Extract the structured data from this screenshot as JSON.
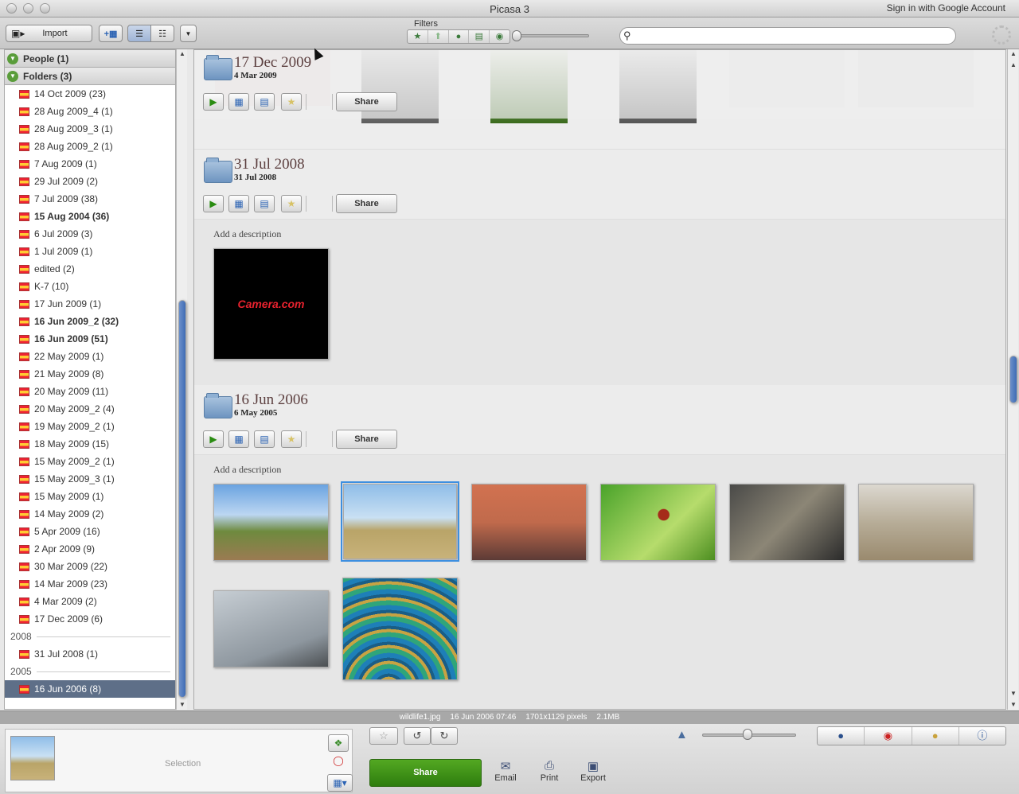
{
  "window": {
    "title": "Picasa 3",
    "signin": "Sign in with Google Account"
  },
  "toolbar": {
    "import_label": "Import",
    "filters_label": "Filters",
    "search_placeholder": ""
  },
  "sidebar": {
    "people": "People (1)",
    "folders": "Folders (3)",
    "items": [
      {
        "label": "14 Oct 2009 (23)",
        "bold": false
      },
      {
        "label": "28 Aug 2009_4 (1)",
        "bold": false
      },
      {
        "label": "28 Aug 2009_3 (1)",
        "bold": false
      },
      {
        "label": "28 Aug 2009_2 (1)",
        "bold": false
      },
      {
        "label": "7 Aug 2009 (1)",
        "bold": false
      },
      {
        "label": "29 Jul 2009 (2)",
        "bold": false
      },
      {
        "label": "7 Jul 2009 (38)",
        "bold": false
      },
      {
        "label": "15 Aug 2004 (36)",
        "bold": true
      },
      {
        "label": "6 Jul 2009 (3)",
        "bold": false
      },
      {
        "label": "1 Jul 2009 (1)",
        "bold": false
      },
      {
        "label": "edited (2)",
        "bold": false
      },
      {
        "label": "K-7 (10)",
        "bold": false
      },
      {
        "label": "17 Jun 2009 (1)",
        "bold": false
      },
      {
        "label": "16 Jun 2009_2 (32)",
        "bold": true
      },
      {
        "label": "16 Jun 2009 (51)",
        "bold": true
      },
      {
        "label": "22 May 2009 (1)",
        "bold": false
      },
      {
        "label": "21 May 2009 (8)",
        "bold": false
      },
      {
        "label": "20 May 2009 (11)",
        "bold": false
      },
      {
        "label": "20 May 2009_2 (4)",
        "bold": false
      },
      {
        "label": "19 May 2009_2 (1)",
        "bold": false
      },
      {
        "label": "18 May 2009 (15)",
        "bold": false
      },
      {
        "label": "15 May 2009_2 (1)",
        "bold": false
      },
      {
        "label": "15 May 2009_3 (1)",
        "bold": false
      },
      {
        "label": "15 May 2009 (1)",
        "bold": false
      },
      {
        "label": "14 May 2009 (2)",
        "bold": false
      },
      {
        "label": "5 Apr 2009 (16)",
        "bold": false
      },
      {
        "label": "2 Apr 2009 (9)",
        "bold": false
      },
      {
        "label": "30 Mar 2009 (22)",
        "bold": false
      },
      {
        "label": "14 Mar 2009 (23)",
        "bold": false
      },
      {
        "label": "4 Mar 2009 (2)",
        "bold": false
      },
      {
        "label": "17 Dec 2009 (6)",
        "bold": false
      }
    ],
    "year_2008": "2008",
    "item_2008": "31 Jul 2008 (1)",
    "year_2005": "2005",
    "item_2005": "16 Jun 2006 (8)"
  },
  "albums": [
    {
      "title": "17 Dec 2009",
      "date": "4 Mar 2009",
      "share": "Share"
    },
    {
      "title": "31 Jul 2008",
      "date": "31 Jul 2008",
      "share": "Share",
      "description": "Add a description"
    },
    {
      "title": "16 Jun 2006",
      "date": "6 May 2005",
      "share": "Share",
      "description": "Add a description"
    }
  ],
  "logo_text": "Camera.com",
  "status": {
    "filename": "wildlife1.jpg",
    "datetime": "16 Jun 2006 07:46",
    "dimensions": "1701x1129 pixels",
    "size": "2.1MB"
  },
  "bottom": {
    "selection": "Selection",
    "share": "Share",
    "email": "Email",
    "print": "Print",
    "export": "Export"
  },
  "colors": {
    "accent_green": "#3d8f16",
    "selection_blue": "#5e6f88"
  }
}
